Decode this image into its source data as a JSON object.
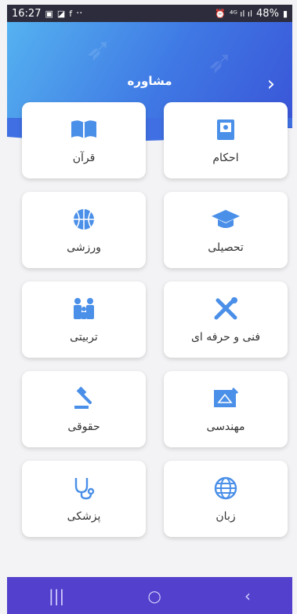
{
  "status": {
    "time": "16:27",
    "battery": "48%",
    "dots": "··",
    "signal": "⁴ᴳ ıl ıl"
  },
  "header": {
    "title": "مشاوره"
  },
  "colors": {
    "accent": "#4a8fe8",
    "nav": "#5340cc"
  },
  "cards": [
    {
      "label": "احکام",
      "icon": "book-icon"
    },
    {
      "label": "قرآن",
      "icon": "quran-icon"
    },
    {
      "label": "تحصیلی",
      "icon": "graduation-cap-icon"
    },
    {
      "label": "ورزشی",
      "icon": "basketball-icon"
    },
    {
      "label": "فنی و حرفه ای",
      "icon": "tools-icon"
    },
    {
      "label": "تربیتی",
      "icon": "family-icon"
    },
    {
      "label": "مهندسی",
      "icon": "blueprint-icon"
    },
    {
      "label": "حقوقی",
      "icon": "gavel-icon"
    },
    {
      "label": "زبان",
      "icon": "globe-icon"
    },
    {
      "label": "پزشکی",
      "icon": "stethoscope-icon"
    }
  ],
  "nav": {
    "recents": "|||",
    "home": "○",
    "back": "‹"
  }
}
